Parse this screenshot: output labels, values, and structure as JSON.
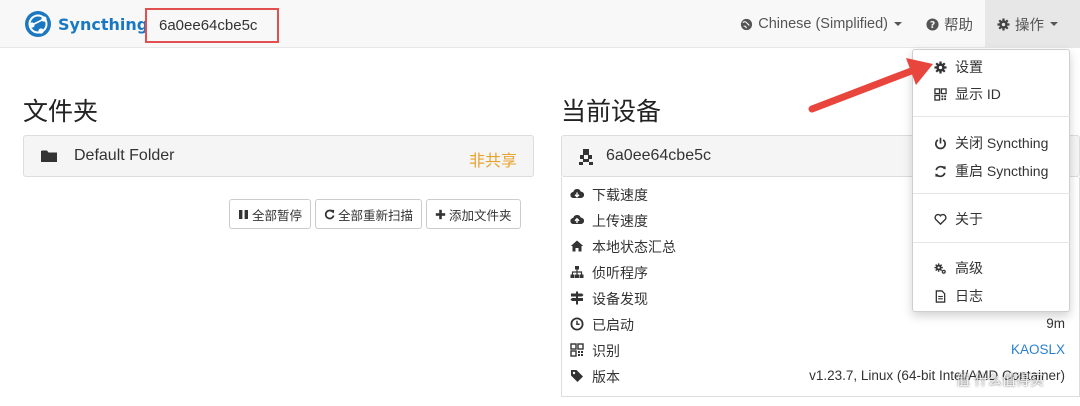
{
  "brand": {
    "name": "Syncthing"
  },
  "navbar": {
    "device_id": "6a0ee64cbe5c",
    "language": "Chinese (Simplified)",
    "help": "帮助",
    "actions": "操作"
  },
  "folders": {
    "heading": "文件夹",
    "items": [
      {
        "name": "Default Folder",
        "status": "非共享"
      }
    ],
    "buttons": {
      "pause_all": "全部暂停",
      "rescan_all": "全部重新扫描",
      "add_folder": "添加文件夹"
    }
  },
  "device": {
    "heading": "当前设备",
    "name": "6a0ee64cbe5c",
    "rows": [
      {
        "label": "下载速度",
        "value": "",
        "icon": "cloud-download-icon"
      },
      {
        "label": "上传速度",
        "value": "",
        "icon": "cloud-upload-icon"
      },
      {
        "label": "本地状态汇总",
        "value": "",
        "icon": "home-icon"
      },
      {
        "label": "侦听程序",
        "value": "",
        "icon": "sitemap-icon"
      },
      {
        "label": "设备发现",
        "value": "",
        "icon": "signpost-icon"
      },
      {
        "label": "已启动",
        "value": "9m",
        "icon": "clock-icon"
      },
      {
        "label": "识别",
        "value": "KAOSLX",
        "icon": "qrcode-icon"
      },
      {
        "label": "版本",
        "value": "v1.23.7, Linux (64-bit Intel/AMD Container)",
        "icon": "tag-icon"
      }
    ]
  },
  "actions_menu": {
    "items": [
      {
        "label": "设置",
        "icon": "gear-icon"
      },
      {
        "label": "显示 ID",
        "icon": "qrcode-icon"
      },
      {
        "label": "关闭 Syncthing",
        "icon": "power-icon"
      },
      {
        "label": "重启 Syncthing",
        "icon": "refresh-icon"
      },
      {
        "label": "关于",
        "icon": "heart-icon"
      },
      {
        "label": "高级",
        "icon": "cogs-icon"
      },
      {
        "label": "日志",
        "icon": "file-icon"
      }
    ]
  },
  "watermark": "值 什么值得买",
  "colors": {
    "brand": "#1a78c2",
    "unshared": "#e8a22e",
    "link": "#2a7fd0",
    "highlight_box": "#e14f4f",
    "arrow": "#e8453c"
  }
}
